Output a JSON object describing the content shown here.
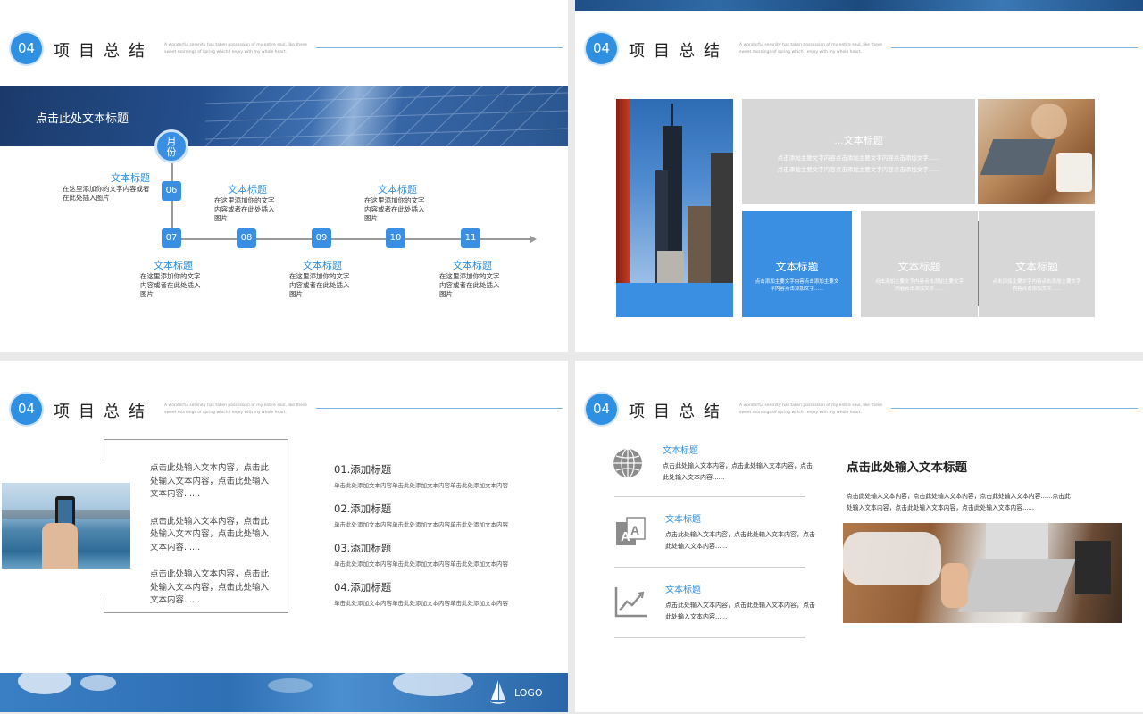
{
  "header": {
    "num": "04",
    "title": "项目总结",
    "subtitle": "A wonderful serenity has taken possession of my entire soul, like these sweet mornings of spring which I enjoy with my whole heart."
  },
  "slide1": {
    "banner_title": "点击此处文本标题",
    "month_label": "月份",
    "nodes": [
      "06",
      "07",
      "08",
      "09",
      "10",
      "11"
    ],
    "items": [
      {
        "title": "文本标题",
        "text": "在这里添加你的文字内容或者在此处插入图片"
      },
      {
        "title": "文本标题",
        "text": "在这里添加你的文字内容或者在此处插入图片"
      },
      {
        "title": "文本标题",
        "text": "在这里添加你的文字内容或者在此处插入图片"
      },
      {
        "title": "文本标题",
        "text": "在这里添加你的文字内容或者在此处插入图片"
      },
      {
        "title": "文本标题",
        "text": "在这里添加你的文字内容或者在此处插入图片"
      },
      {
        "title": "文本标题",
        "text": "在这里添加你的文字内容或者在此处插入图片"
      }
    ]
  },
  "slide2": {
    "top_title": "...文本标题",
    "top_text": "点击添加主要文字内容点击添加主要文字内容点击添加文字......点击添加主要文字内容点击添加主要文字内容点击添加文字......",
    "boxes": [
      {
        "title": "文本标题",
        "text": "点击添加主要文字内容点击添加主要文字内容点击添加文字......"
      },
      {
        "title": "文本标题",
        "text": "点击添加主要文字内容点击添加主要文字内容点击添加文字......"
      },
      {
        "title": "文本标题",
        "text": "点击添加主要文字内容点击添加主要文字内容点击添加文字......"
      }
    ]
  },
  "slide3": {
    "paras": [
      "点击此处输入文本内容，点击此处输入文本内容，点击此处输入文本内容......",
      "点击此处输入文本内容，点击此处输入文本内容，点击此处输入文本内容......",
      "点击此处输入文本内容，点击此处输入文本内容，点击此处输入文本内容......"
    ],
    "list": [
      {
        "title": "01.添加标题",
        "text": "单击此处添加文本内容单击此处添加文本内容单击此处添加文本内容"
      },
      {
        "title": "02.添加标题",
        "text": "单击此处添加文本内容单击此处添加文本内容单击此处添加文本内容"
      },
      {
        "title": "03.添加标题",
        "text": "单击此处添加文本内容单击此处添加文本内容单击此处添加文本内容"
      },
      {
        "title": "04.添加标题",
        "text": "单击此处添加文本内容单击此处添加文本内容单击此处添加文本内容"
      }
    ],
    "logo": "LOGO"
  },
  "slide4": {
    "items": [
      {
        "icon": "globe-icon",
        "title": "文本标题",
        "text": "点击此处输入文本内容，点击此处输入文本内容，点击此处输入文本内容......"
      },
      {
        "icon": "text-icon",
        "title": "文本标题",
        "text": "点击此处输入文本内容，点击此处输入文本内容，点击此处输入文本内容......"
      },
      {
        "icon": "chart-icon",
        "title": "文本标题",
        "text": "点击此处输入文本内容，点击此处输入文本内容，点击此处输入文本内容......"
      }
    ],
    "heading": "点击此处输入文本标题",
    "body": "点击此处输入文本内容，点击此处输入文本内容，点击此处输入文本内容......点击此处输入文本内容，点击此处输入文本内容，点击此处输入文本内容......"
  }
}
